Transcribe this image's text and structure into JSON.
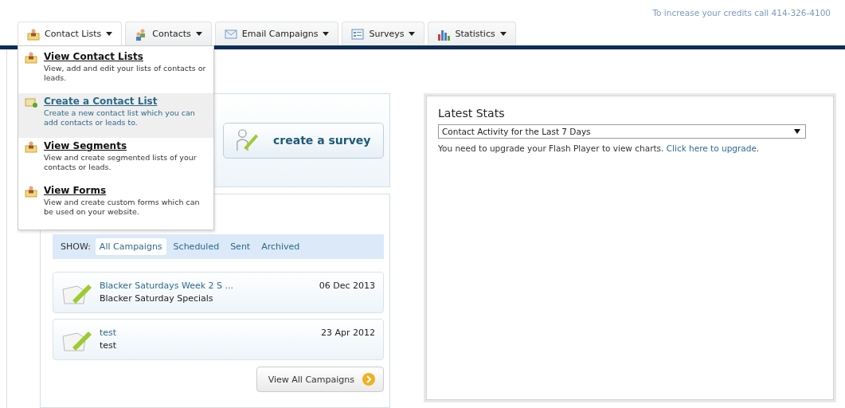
{
  "credits_note": "To increase your credits call 414-326-4100",
  "tabs": [
    {
      "label": "Contact Lists",
      "kind": "person",
      "open": true
    },
    {
      "label": "Contacts",
      "kind": "people",
      "open": false
    },
    {
      "label": "Email Campaigns",
      "kind": "envelope",
      "open": false
    },
    {
      "label": "Surveys",
      "kind": "form",
      "open": false
    },
    {
      "label": "Statistics",
      "kind": "bars",
      "open": false
    }
  ],
  "dropdown": [
    {
      "title": "View Contact Lists",
      "description": "View, add and edit your lists of contacts or leads.",
      "kind": "person",
      "selected": false
    },
    {
      "title": "Create a Contact List",
      "description": "Create a new contact list which you can add contacts or leads to.",
      "kind": "folder-add",
      "selected": true
    },
    {
      "title": "View Segments",
      "description": "View and create segmented lists of your contacts or leads.",
      "kind": "person",
      "selected": false
    },
    {
      "title": "View Forms",
      "description": "View and create custom forms which can be used on your website.",
      "kind": "person",
      "selected": false
    }
  ],
  "create_survey_button": "create a survey",
  "campaign_filter": {
    "label": "SHOW:",
    "options": [
      {
        "label": "All Campaigns",
        "selected": true
      },
      {
        "label": "Scheduled",
        "selected": false
      },
      {
        "label": "Sent",
        "selected": false
      },
      {
        "label": "Archived",
        "selected": false
      }
    ]
  },
  "campaigns": [
    {
      "name": "Blacker Saturdays Week 2 S ...",
      "subject": "Blacker Saturday Specials",
      "date": "06 Dec 2013"
    },
    {
      "name": "test",
      "subject": "test",
      "date": "23 Apr 2012"
    }
  ],
  "view_all_button": "View All Campaigns",
  "latest_stats": {
    "title": "Latest Stats",
    "select_value": "Contact Activity for the Last 7 Days",
    "message": "You need to upgrade your Flash Player to view charts.",
    "link": "Click here to upgrade",
    "message_end": "."
  }
}
